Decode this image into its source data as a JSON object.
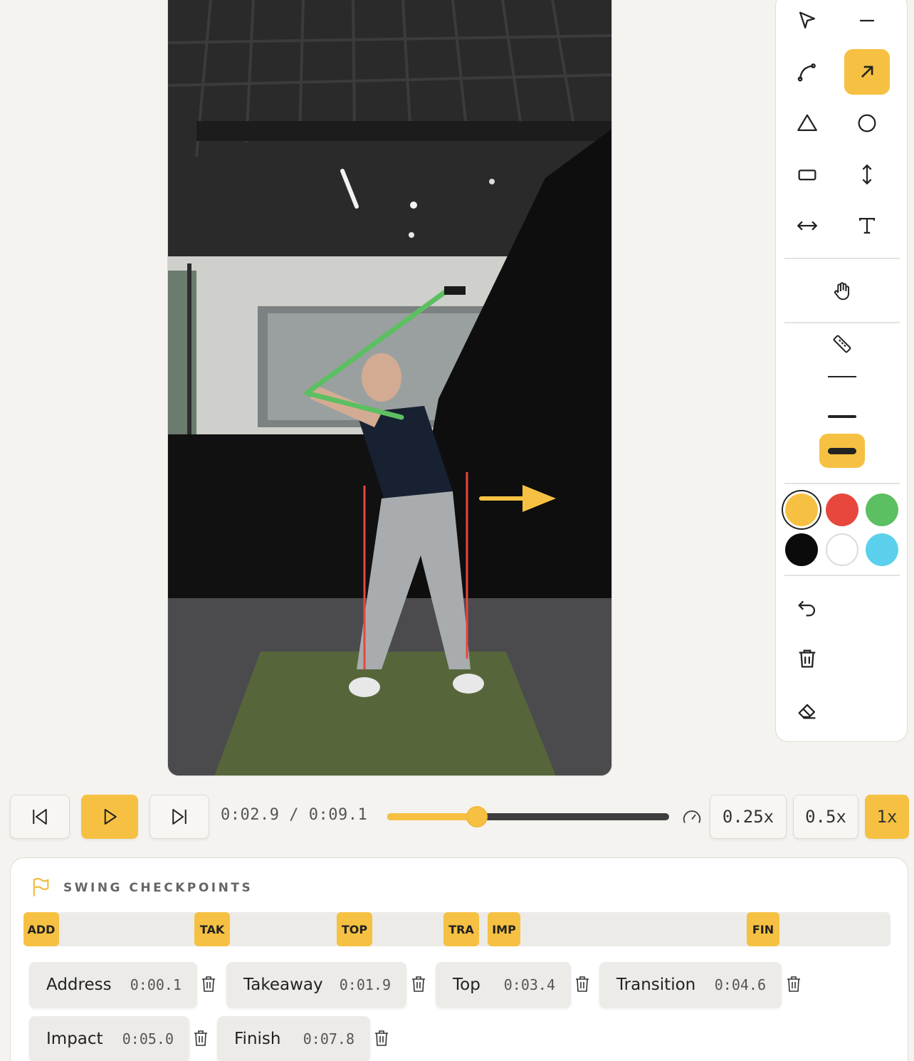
{
  "tools": {
    "items": [
      {
        "name": "select",
        "icon": "pointer-icon"
      },
      {
        "name": "line",
        "icon": "line-icon"
      },
      {
        "name": "curve",
        "icon": "curve-icon"
      },
      {
        "name": "arrow",
        "icon": "arrow-icon",
        "active": true
      },
      {
        "name": "triangle",
        "icon": "triangle-icon"
      },
      {
        "name": "circle",
        "icon": "circle-icon"
      },
      {
        "name": "rectangle",
        "icon": "rectangle-icon"
      },
      {
        "name": "vertical-measure",
        "icon": "vertical-arrows-icon"
      },
      {
        "name": "horizontal-measure",
        "icon": "horizontal-arrows-icon"
      },
      {
        "name": "text",
        "icon": "text-icon"
      },
      {
        "name": "pan",
        "icon": "hand-icon"
      },
      {
        "name": "ruler",
        "icon": "ruler-icon"
      }
    ],
    "stroke_widths": [
      "thin",
      "medium",
      "thick"
    ],
    "selected_stroke": "thick",
    "colors": [
      "#f6c142",
      "#e8473d",
      "#5cbf61",
      "#0b0b0b",
      "#ffffff",
      "#5bd0ec"
    ],
    "selected_color": "#f6c142",
    "actions": [
      "undo-icon",
      "trash-icon",
      "eraser-icon"
    ]
  },
  "player": {
    "current_time": "0:02.9",
    "separator": "/",
    "duration": "0:09.1",
    "progress": 0.3187,
    "speeds": [
      "0.25x",
      "0.5x",
      "1x"
    ],
    "active_speed": "1x",
    "accent": "#f6c142"
  },
  "checkpoints": {
    "title": "SWING CHECKPOINTS",
    "markers": [
      {
        "code": "ADD",
        "time_s": 0.1
      },
      {
        "code": "TAK",
        "time_s": 1.9
      },
      {
        "code": "TOP",
        "time_s": 3.4
      },
      {
        "code": "TRA",
        "time_s": 4.6
      },
      {
        "code": "IMP",
        "time_s": 5.0
      },
      {
        "code": "FIN",
        "time_s": 7.8
      }
    ],
    "items": [
      {
        "name": "Address",
        "time": "0:00.1"
      },
      {
        "name": "Takeaway",
        "time": "0:01.9"
      },
      {
        "name": "Top",
        "time": "0:03.4"
      },
      {
        "name": "Transition",
        "time": "0:04.6"
      },
      {
        "name": "Impact",
        "time": "0:05.0"
      },
      {
        "name": "Finish",
        "time": "0:07.8"
      }
    ]
  }
}
